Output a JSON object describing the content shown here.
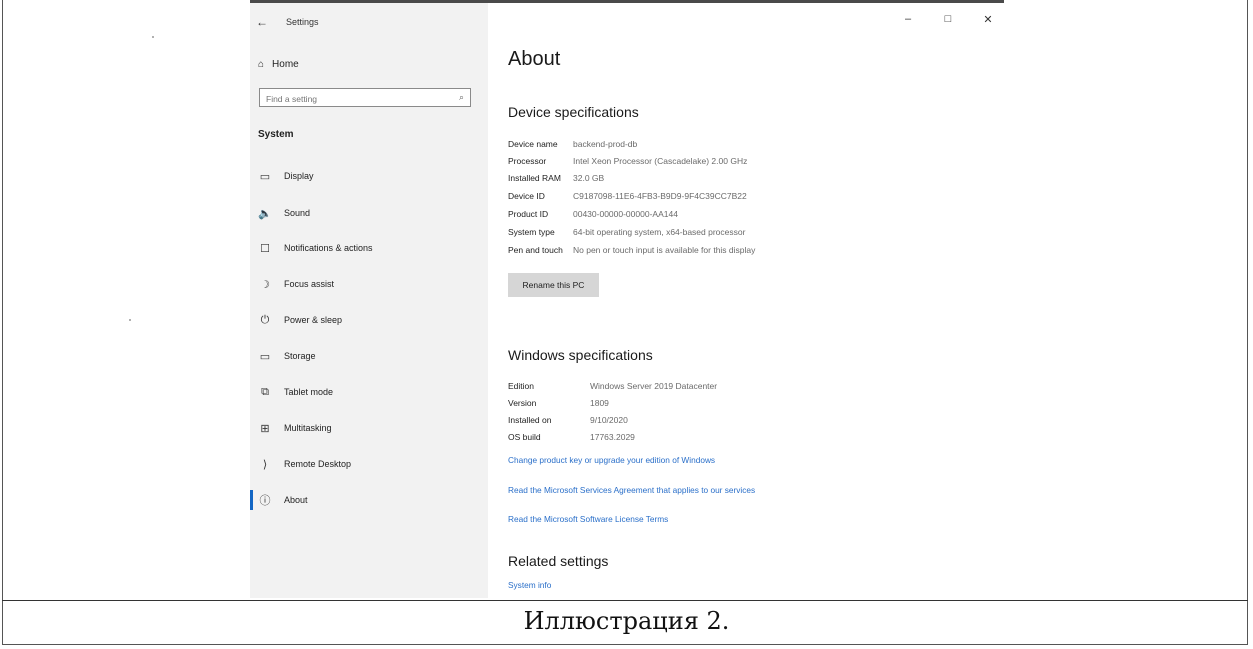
{
  "window": {
    "title": "Settings",
    "back_icon": "←",
    "controls": {
      "minimize": "–",
      "maximize": "□",
      "close": "✕"
    }
  },
  "sidebar": {
    "home_label": "Home",
    "search_placeholder": "Find a setting",
    "section_title": "System",
    "items": [
      {
        "label": "Display",
        "icon": "display-icon",
        "glyph": "▭"
      },
      {
        "label": "Sound",
        "icon": "sound-icon",
        "glyph": "🔈"
      },
      {
        "label": "Notifications & actions",
        "icon": "notifications-icon",
        "glyph": "☐"
      },
      {
        "label": "Focus assist",
        "icon": "focus-assist-icon",
        "glyph": "☽"
      },
      {
        "label": "Power & sleep",
        "icon": "power-icon",
        "glyph": "⏻"
      },
      {
        "label": "Storage",
        "icon": "storage-icon",
        "glyph": "▭"
      },
      {
        "label": "Tablet mode",
        "icon": "tablet-mode-icon",
        "glyph": "⧉"
      },
      {
        "label": "Multitasking",
        "icon": "multitasking-icon",
        "glyph": "⊞"
      },
      {
        "label": "Remote Desktop",
        "icon": "remote-desktop-icon",
        "glyph": "⟩"
      },
      {
        "label": "About",
        "icon": "about-icon",
        "glyph": "ⓘ",
        "selected": true
      }
    ]
  },
  "main": {
    "title": "About",
    "device_specs": {
      "heading": "Device specifications",
      "rows": [
        {
          "key": "Device name",
          "value": "backend-prod-db"
        },
        {
          "key": "Processor",
          "value": "Intel Xeon Processor (Cascadelake)   2.00 GHz"
        },
        {
          "key": "Installed RAM",
          "value": "32.0 GB"
        },
        {
          "key": "Device ID",
          "value": "C9187098-11E6-4FB3-B9D9-9F4C39CC7B22"
        },
        {
          "key": "Product ID",
          "value": "00430-00000-00000-AA144"
        },
        {
          "key": "System type",
          "value": "64-bit operating system, x64-based processor"
        },
        {
          "key": "Pen and touch",
          "value": "No pen or touch input is available for this display"
        }
      ],
      "rename_button": "Rename this PC"
    },
    "windows_specs": {
      "heading": "Windows specifications",
      "rows": [
        {
          "key": "Edition",
          "value": "Windows Server 2019 Datacenter"
        },
        {
          "key": "Version",
          "value": "1809"
        },
        {
          "key": "Installed on",
          "value": "9/10/2020"
        },
        {
          "key": "OS build",
          "value": "17763.2029"
        }
      ],
      "links": [
        "Change product key or upgrade your edition of Windows",
        "Read the Microsoft Services Agreement that applies to our services",
        "Read the Microsoft Software License Terms"
      ]
    },
    "related": {
      "heading": "Related settings",
      "link": "System info"
    }
  },
  "caption": "Иллюстрация 2.",
  "colors": {
    "accent": "#1366c4",
    "link": "#2a6fc9",
    "sidebar_bg": "#f2f2f2"
  }
}
